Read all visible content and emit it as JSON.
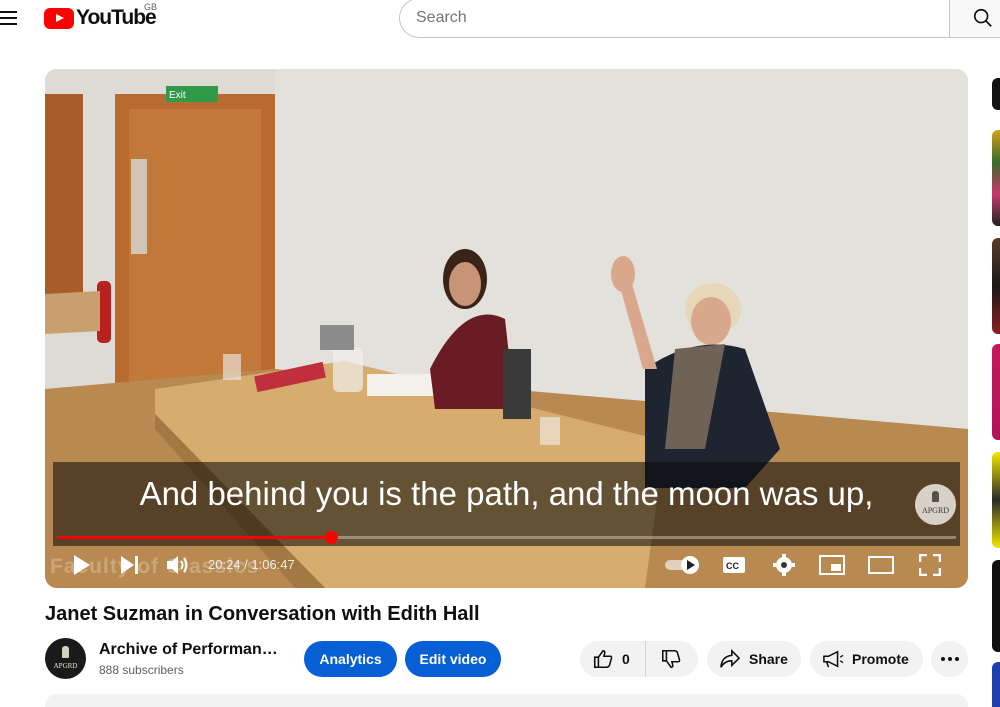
{
  "header": {
    "logo_text": "YouTube",
    "region": "GB",
    "search_placeholder": "Search",
    "icons": [
      "menu-icon",
      "youtube-logo-icon",
      "search-icon"
    ]
  },
  "player": {
    "caption": "And behind you is the path, and the moon was up,",
    "watermark_text": "Faculty of Classics",
    "channel_bug": "APGRD",
    "current_time": "20:24",
    "duration": "1:06:47",
    "time_display": "20:24 / 1:06:47",
    "progress_fraction": 0.305,
    "progress_color": "#ff0000",
    "controls": [
      "play-icon",
      "next-icon",
      "volume-icon",
      "autoplay-toggle-icon",
      "subtitles-icon",
      "settings-icon",
      "miniplayer-icon",
      "theater-mode-icon",
      "fullscreen-icon"
    ]
  },
  "video": {
    "title": "Janet Suzman in Conversation with Edith Hall"
  },
  "channel": {
    "name": "Archive of Performances of Greek and Roman Drama",
    "avatar_text": "APGRD",
    "subscribers": "888 subscribers"
  },
  "actions": {
    "analytics_label": "Analytics",
    "edit_label": "Edit video",
    "like_count": "0",
    "share_label": "Share",
    "promote_label": "Promote",
    "accent_color": "#065fd4"
  }
}
